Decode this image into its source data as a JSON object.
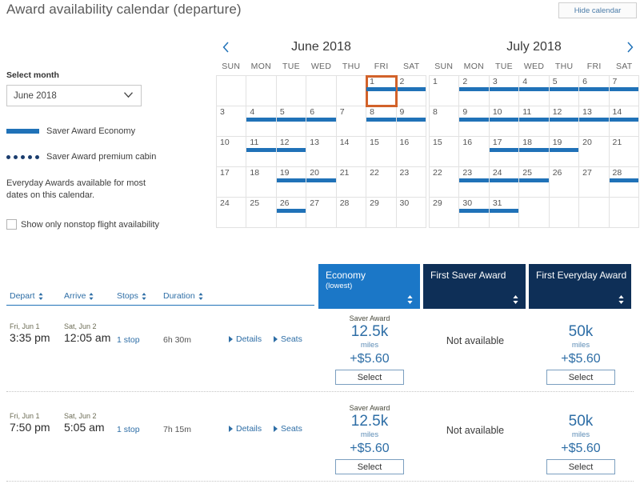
{
  "header": {
    "title": "Award availability calendar (departure)",
    "hide_calendar_label": "Hide calendar"
  },
  "left_panel": {
    "select_month_label": "Select month",
    "selected_month": "June 2018",
    "legend": [
      {
        "style": "solid",
        "label": "Saver Award Economy",
        "color": "#2072b8"
      },
      {
        "style": "dots",
        "label": "Saver Award premium cabin",
        "color": "#1b3d6e"
      }
    ],
    "note": "Everyday Awards available for most dates on this calendar.",
    "nonstop_label": "Show only nonstop flight availability",
    "nonstop_checked": false
  },
  "calendars": [
    {
      "title": "June 2018",
      "prev_arrow": "chevron-left",
      "next_arrow": null,
      "dow": [
        "SUN",
        "MON",
        "TUE",
        "WED",
        "THU",
        "FRI",
        "SAT"
      ],
      "weeks": [
        [
          null,
          null,
          null,
          null,
          null,
          1,
          2
        ],
        [
          3,
          4,
          5,
          6,
          7,
          8,
          9
        ],
        [
          10,
          11,
          12,
          13,
          14,
          15,
          16
        ],
        [
          17,
          18,
          19,
          20,
          21,
          22,
          23
        ],
        [
          24,
          25,
          26,
          27,
          28,
          29,
          30
        ]
      ],
      "saver_days": [
        1,
        2,
        4,
        5,
        6,
        8,
        9,
        11,
        12,
        19,
        20,
        26
      ],
      "selected_day": 1
    },
    {
      "title": "July 2018",
      "prev_arrow": null,
      "next_arrow": "chevron-right",
      "dow": [
        "SUN",
        "MON",
        "TUE",
        "WED",
        "THU",
        "FRI",
        "SAT"
      ],
      "weeks": [
        [
          1,
          2,
          3,
          4,
          5,
          6,
          7
        ],
        [
          8,
          9,
          10,
          11,
          12,
          13,
          14
        ],
        [
          15,
          16,
          17,
          18,
          19,
          20,
          21
        ],
        [
          22,
          23,
          24,
          25,
          26,
          27,
          28
        ],
        [
          29,
          30,
          31,
          null,
          null,
          null,
          null
        ]
      ],
      "saver_days": [
        2,
        3,
        4,
        5,
        6,
        7,
        9,
        10,
        11,
        12,
        13,
        14,
        17,
        18,
        19,
        23,
        24,
        25,
        28,
        30,
        31
      ],
      "selected_day": null
    }
  ],
  "fare_columns": [
    {
      "line1": "Economy",
      "line2": "(lowest)",
      "selected": true
    },
    {
      "line1": "First Saver Award",
      "line2": "",
      "selected": false
    },
    {
      "line1": "First Everyday Award",
      "line2": "",
      "selected": false
    }
  ],
  "table": {
    "columns": [
      {
        "label": "Depart"
      },
      {
        "label": "Arrive"
      },
      {
        "label": "Stops"
      },
      {
        "label": "Duration"
      }
    ],
    "details_label": "Details",
    "seats_label": "Seats",
    "select_label": "Select",
    "not_available_label": "Not available",
    "rows": [
      {
        "depart_date": "Fri, Jun 1",
        "depart_time": "3:35 pm",
        "arrive_date": "Sat, Jun 2",
        "arrive_time": "12:05 am",
        "stops": "1 stop",
        "duration": "6h 30m",
        "fares": [
          {
            "award_label": "Saver Award",
            "miles": "12.5k",
            "miles_unit": "miles",
            "fee": "+$5.60",
            "available": true
          },
          {
            "award_label": "",
            "miles": "",
            "miles_unit": "",
            "fee": "",
            "available": false
          },
          {
            "award_label": "",
            "miles": "50k",
            "miles_unit": "miles",
            "fee": "+$5.60",
            "available": true
          }
        ]
      },
      {
        "depart_date": "Fri, Jun 1",
        "depart_time": "7:50 pm",
        "arrive_date": "Sat, Jun 2",
        "arrive_time": "5:05 am",
        "stops": "1 stop",
        "duration": "7h 15m",
        "fares": [
          {
            "award_label": "Saver Award",
            "miles": "12.5k",
            "miles_unit": "miles",
            "fee": "+$5.60",
            "available": true
          },
          {
            "award_label": "",
            "miles": "",
            "miles_unit": "",
            "fee": "",
            "available": false
          },
          {
            "award_label": "",
            "miles": "50k",
            "miles_unit": "miles",
            "fee": "+$5.60",
            "available": true
          }
        ]
      }
    ]
  },
  "colors": {
    "accent_blue": "#2072b8",
    "tab_selected": "#1b77c7",
    "tab_alt": "#0e2f57",
    "selected_day_border": "#d2622a",
    "link": "#2e6ea6"
  }
}
